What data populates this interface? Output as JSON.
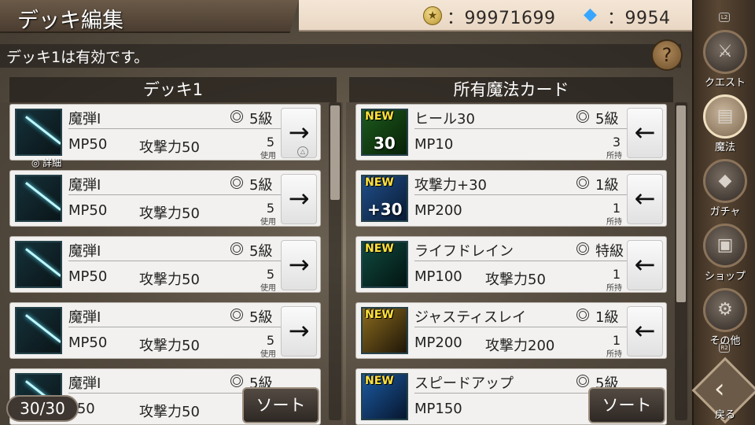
{
  "header": {
    "title": "デッキ編集",
    "coin_label": "：99971699",
    "gem_label": "：9954"
  },
  "status": {
    "message": "デッキ1は有効です。",
    "help": "?"
  },
  "deck": {
    "title": "デッキ1",
    "count_label": "30/30",
    "sort_label": "ソート",
    "detail_label": "◎ 詳細",
    "cards": [
      {
        "name": "魔弾Ⅰ",
        "rank": "5級",
        "mp": "MP50",
        "atk": "攻撃力50",
        "count": "5",
        "count_label": "使用",
        "action": "→"
      },
      {
        "name": "魔弾Ⅰ",
        "rank": "5級",
        "mp": "MP50",
        "atk": "攻撃力50",
        "count": "5",
        "count_label": "使用",
        "action": "→"
      },
      {
        "name": "魔弾Ⅰ",
        "rank": "5級",
        "mp": "MP50",
        "atk": "攻撃力50",
        "count": "5",
        "count_label": "使用",
        "action": "→"
      },
      {
        "name": "魔弾Ⅰ",
        "rank": "5級",
        "mp": "MP50",
        "atk": "攻撃力50",
        "count": "5",
        "count_label": "使用",
        "action": "→"
      },
      {
        "name": "魔弾Ⅰ",
        "rank": "5級",
        "mp": "P50",
        "atk": "攻撃力50",
        "count": "",
        "count_label": "",
        "action": ""
      }
    ]
  },
  "owned": {
    "title": "所有魔法カード",
    "sort_label": "ソート",
    "cards": [
      {
        "badge": "NEW",
        "thumb_text": "30",
        "name": "ヒール30",
        "rank": "5級",
        "mp": "MP10",
        "atk": "",
        "count": "3",
        "count_label": "所持",
        "action": "←"
      },
      {
        "badge": "NEW",
        "thumb_text": "+30",
        "name": "攻撃力+30",
        "rank": "1級",
        "mp": "MP200",
        "atk": "",
        "count": "1",
        "count_label": "所持",
        "action": "←"
      },
      {
        "badge": "NEW",
        "thumb_text": "",
        "name": "ライフドレイン",
        "rank": "特級",
        "mp": "MP100",
        "atk": "攻撃力50",
        "count": "1",
        "count_label": "所持",
        "action": "←"
      },
      {
        "badge": "NEW",
        "thumb_text": "",
        "name": "ジャスティスレイ",
        "rank": "1級",
        "mp": "MP200",
        "atk": "攻撃力200",
        "count": "1",
        "count_label": "所持",
        "action": "←"
      },
      {
        "badge": "NEW",
        "thumb_text": "",
        "name": "スピードアップ",
        "rank": "5級",
        "mp": "MP150",
        "atk": "",
        "count": "",
        "count_label": "",
        "action": ""
      }
    ]
  },
  "sidebar": {
    "items": [
      {
        "label": "クエスト",
        "icon": "sword-icon"
      },
      {
        "label": "魔法",
        "icon": "book-icon"
      },
      {
        "label": "ガチャ",
        "icon": "crystal-icon"
      },
      {
        "label": "ショップ",
        "icon": "chest-icon"
      },
      {
        "label": "その他",
        "icon": "gear-icon"
      }
    ],
    "back_label": "戻る",
    "shoulder_top": "L2",
    "shoulder_bottom": "R2"
  }
}
